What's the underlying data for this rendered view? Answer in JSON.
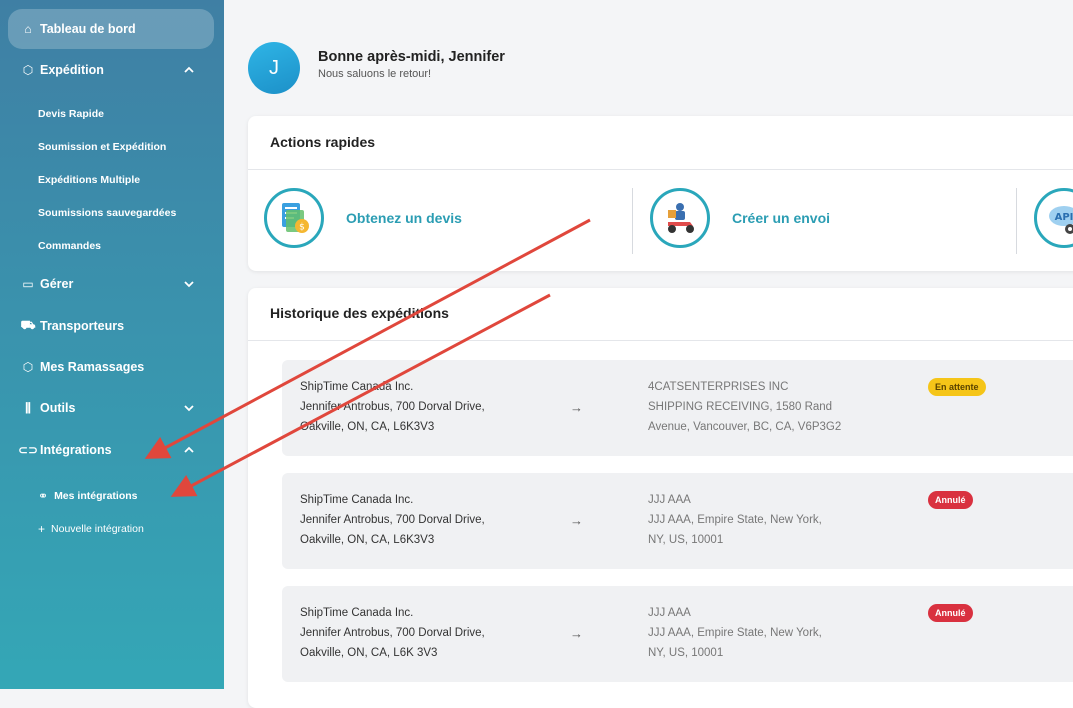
{
  "sidebar": {
    "dashboard": "Tableau de bord",
    "expedition": "Expédition",
    "expedition_items": [
      "Devis Rapide",
      "Soumission et Expédition",
      "Expéditions Multiple",
      "Soumissions sauvegardées",
      "Commandes"
    ],
    "gerer": "Gérer",
    "transporteurs": "Transporteurs",
    "ramassages": "Mes Ramassages",
    "outils": "Outils",
    "integrations": "Intégrations",
    "mes_integrations": "Mes intégrations",
    "nouvelle_integration": "Nouvelle intégration"
  },
  "user": {
    "initial": "J",
    "greeting": "Bonne après-midi, Jennifer",
    "welcome": "Nous saluons le retour!"
  },
  "quick_actions": {
    "title": "Actions rapides",
    "quote": "Obtenez un devis",
    "shipment": "Créer un envoi",
    "api_text": "API"
  },
  "history": {
    "title": "Historique des expéditions",
    "arrow": "→",
    "rows": [
      {
        "from": [
          "ShipTime Canada Inc.",
          "Jennifer Antrobus, 700 Dorval Drive,",
          "Oakville, ON, CA, L6K3V3"
        ],
        "to": [
          "4CATSENTERPRISES INC",
          "SHIPPING RECEIVING, 1580 Rand",
          "Avenue, Vancouver, BC, CA, V6P3G2"
        ],
        "status": "En attente"
      },
      {
        "from": [
          "ShipTime Canada Inc.",
          "Jennifer Antrobus, 700 Dorval Drive,",
          "Oakville, ON, CA, L6K3V3"
        ],
        "to": [
          "JJJ AAA",
          "JJJ AAA, Empire State, New York,",
          "NY, US, 10001"
        ],
        "status": "Annulé"
      },
      {
        "from": [
          "ShipTime Canada Inc.",
          "Jennifer Antrobus, 700 Dorval Drive,",
          "Oakville, ON, CA, L6K 3V3"
        ],
        "to": [
          "JJJ AAA",
          "JJJ AAA, Empire State, New York,",
          "NY, US, 10001"
        ],
        "status": "Annulé"
      }
    ]
  },
  "colors": {
    "accent": "#2aa7bb",
    "annotation_arrow": "#e0473c",
    "pending": "#f5c518",
    "cancelled": "#d9313f"
  }
}
